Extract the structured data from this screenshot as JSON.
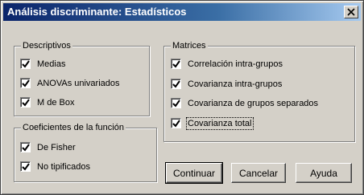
{
  "window": {
    "title": "Análisis discriminante: Estadísticos"
  },
  "descriptivos": {
    "legend": "Descriptivos",
    "items": [
      {
        "label": "Medias",
        "checked": true
      },
      {
        "label": "ANOVAs univariados",
        "checked": true
      },
      {
        "label": "M de Box",
        "checked": true
      }
    ]
  },
  "coeficientes": {
    "legend": "Coeficientes de la función",
    "items": [
      {
        "label": "De Fisher",
        "checked": true
      },
      {
        "label": "No tipificados",
        "checked": true
      }
    ]
  },
  "matrices": {
    "legend": "Matrices",
    "items": [
      {
        "label": "Correlación intra-grupos",
        "checked": true
      },
      {
        "label": "Covarianza intra-grupos",
        "checked": true
      },
      {
        "label": "Covarianza de grupos separados",
        "checked": true
      },
      {
        "label": "Covarianza total",
        "checked": true
      }
    ]
  },
  "buttons": {
    "continuar": "Continuar",
    "cancelar": "Cancelar",
    "ayuda": "Ayuda"
  }
}
